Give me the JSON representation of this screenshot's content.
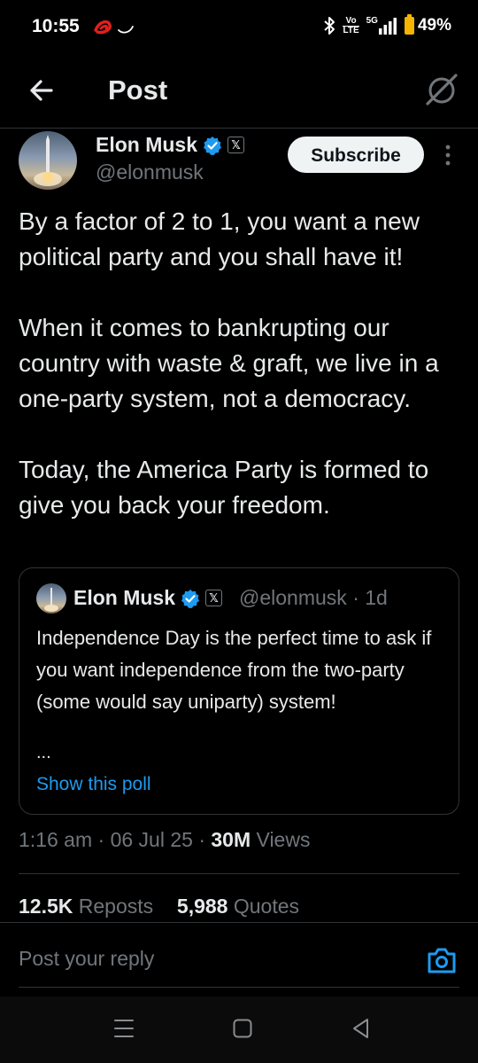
{
  "status_bar": {
    "time": "10:55",
    "volte_top": "Vo",
    "volte_bottom": "LTE",
    "network": "5G",
    "battery": "49%"
  },
  "header": {
    "title": "Post",
    "back_icon": "arrow-left-icon",
    "grok_icon": "grok-icon"
  },
  "tweet": {
    "author_name": "Elon Musk",
    "author_handle": "@elonmusk",
    "affiliate_badge": "𝕏",
    "subscribe_label": "Subscribe",
    "text": "By a factor of 2 to 1, you want a new political party and you shall have it!\n\nWhen it comes to bankrupting our country with waste & graft, we live in a one-party system, not a democracy.\n\nToday, the America Party is formed to give you back your freedom.",
    "time": "1:16 am",
    "date": "06 Jul 25",
    "views_count": "30M",
    "views_label": "Views",
    "reposts_count": "12.5K",
    "reposts_label": "Reposts",
    "quotes_count": "5,988",
    "quotes_label": "Quotes"
  },
  "quoted_tweet": {
    "author_name": "Elon Musk",
    "author_handle": "@elonmusk",
    "age": "1d",
    "affiliate_badge": "𝕏",
    "text": "Independence Day is the perfect time to ask if you want independence from the two-party (some would say uniparty) system!",
    "ellipsis": "...",
    "poll_link": "Show this poll"
  },
  "reply": {
    "placeholder": "Post your reply"
  },
  "colors": {
    "background": "#000000",
    "text": "#e7e9ea",
    "secondary": "#71767b",
    "accent": "#1d9bf0",
    "border": "#2f3336"
  }
}
